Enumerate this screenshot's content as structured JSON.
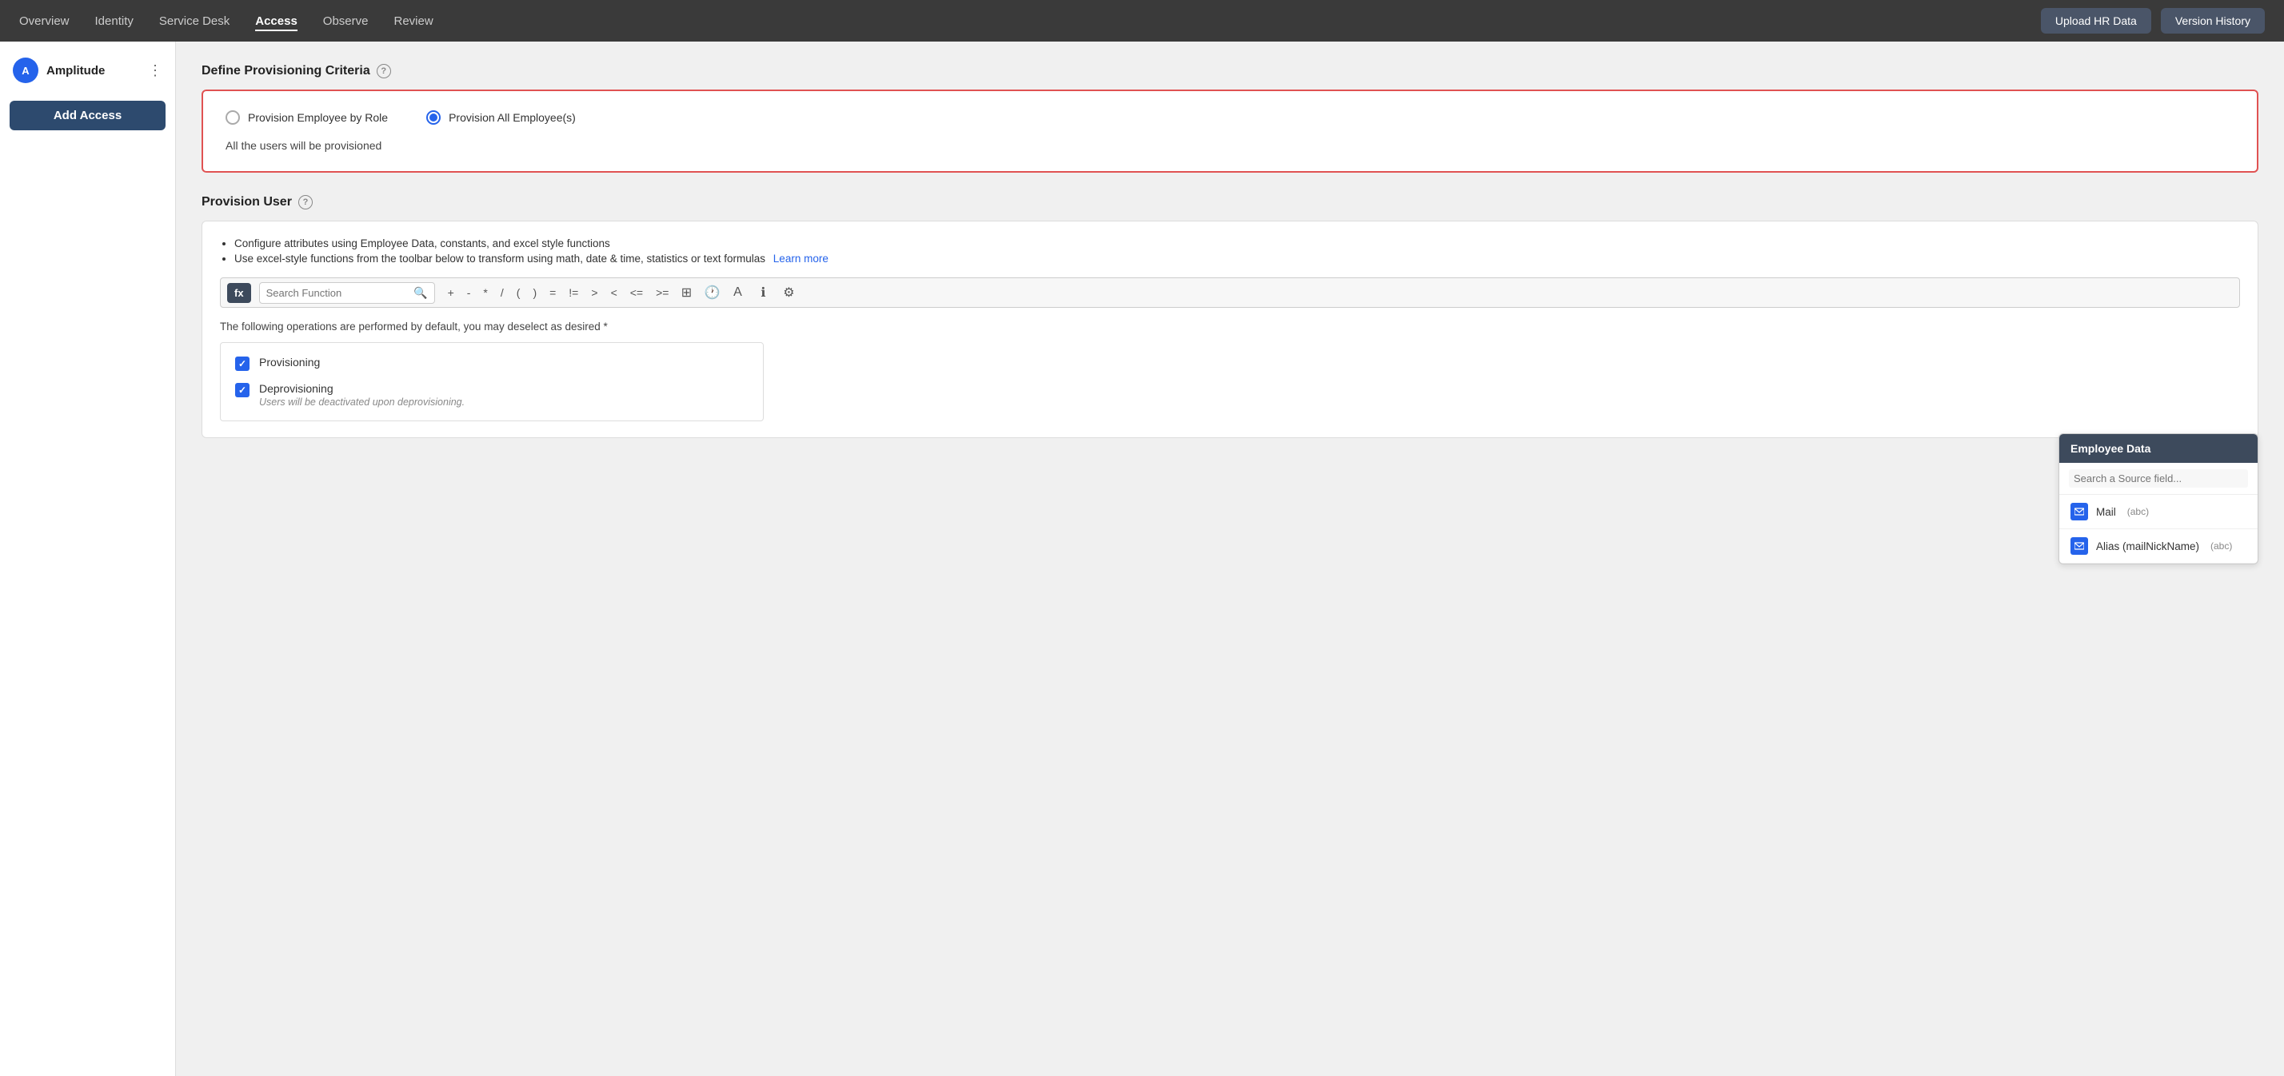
{
  "topNav": {
    "links": [
      {
        "id": "overview",
        "label": "Overview",
        "active": false
      },
      {
        "id": "identity",
        "label": "Identity",
        "active": false
      },
      {
        "id": "service-desk",
        "label": "Service Desk",
        "active": false
      },
      {
        "id": "access",
        "label": "Access",
        "active": true
      },
      {
        "id": "observe",
        "label": "Observe",
        "active": false
      },
      {
        "id": "review",
        "label": "Review",
        "active": false
      }
    ],
    "uploadButton": "Upload HR Data",
    "versionButton": "Version History"
  },
  "sidebar": {
    "brandName": "Amplitude",
    "brandInitial": "A",
    "addAccessLabel": "Add Access"
  },
  "defineSection": {
    "title": "Define Provisioning Criteria",
    "options": [
      {
        "id": "by-role",
        "label": "Provision Employee by Role",
        "selected": false
      },
      {
        "id": "all",
        "label": "Provision All Employee(s)",
        "selected": true
      }
    ],
    "note": "All the users will be provisioned"
  },
  "provisionUserSection": {
    "title": "Provision User",
    "bullets": [
      "Configure attributes using Employee Data, constants, and excel style functions",
      "Use excel-style functions from the toolbar below to transform using math, date & time, statistics or text formulas"
    ],
    "learnMoreLabel": "Learn more",
    "toolbar": {
      "fxLabel": "fx",
      "searchPlaceholder": "Search Function",
      "operators": [
        "+",
        "-",
        "*",
        "/",
        "(",
        ")",
        "=",
        "!=",
        ">",
        "<",
        "<=",
        ">="
      ]
    },
    "operationsText": "The following operations are performed by default, you may deselect as desired *",
    "operations": [
      {
        "id": "provisioning",
        "label": "Provisioning",
        "checked": true,
        "subLabel": ""
      },
      {
        "id": "deprovisioning",
        "label": "Deprovisioning",
        "checked": true,
        "subLabel": "Users will be deactivated upon deprovisioning."
      }
    ]
  },
  "employeeDataPanel": {
    "title": "Employee Data",
    "searchPlaceholder": "Search a Source field...",
    "items": [
      {
        "name": "Mail",
        "type": "(abc)"
      },
      {
        "name": "Alias (mailNickName)",
        "type": "(abc)"
      }
    ]
  }
}
